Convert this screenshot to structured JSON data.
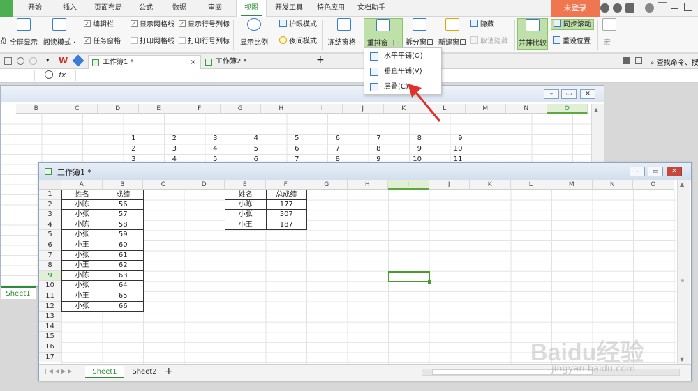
{
  "tabs": [
    "开始",
    "插入",
    "页面布局",
    "公式",
    "数据",
    "审阅",
    "视图",
    "开发工具",
    "特色应用",
    "文档助手"
  ],
  "login": "未登录",
  "ribbon": {
    "zoom_left": "览",
    "fullscreen": "全屏显示",
    "reading": "阅读模式 ·",
    "edit_bar": "编辑栏",
    "task_pane": "任务窗格",
    "show_grid": "显示网格线",
    "show_headers": "显示行号列标",
    "print_grid": "打印网格线",
    "print_headers": "打印行号列标",
    "zoom": "显示比例",
    "eye": "护眼模式",
    "night": "夜间模式",
    "freeze": "冻结窗格 ·",
    "arrange": "重排窗口 ·",
    "split": "拆分窗口",
    "new_window": "新建窗口",
    "hide": "隐藏",
    "unhide": "取消隐藏",
    "side_by_side": "并排比较",
    "sync_scroll": "同步滚动",
    "reset_pos": "重设位置",
    "macro": "宏 ·"
  },
  "doctabs": {
    "active": "工作簿1 *",
    "second": "工作簿2 *",
    "plus": "+",
    "search": "查找命令、搜"
  },
  "formula": {
    "fx": "fx"
  },
  "dropdown": {
    "horizontal": "水平平铺(O)",
    "vertical": "垂直平铺(V)",
    "cascade": "层叠(C)"
  },
  "back_window": {
    "columns": [
      "B",
      "C",
      "D",
      "E",
      "F",
      "G",
      "H",
      "I",
      "J",
      "K",
      "L",
      "M",
      "N",
      "O"
    ],
    "rows": [
      [
        "1",
        "2",
        "3",
        "4",
        "5",
        "6",
        "7",
        "8",
        "9"
      ],
      [
        "2",
        "3",
        "4",
        "5",
        "6",
        "7",
        "8",
        "9",
        "10"
      ],
      [
        "3",
        "4",
        "5",
        "6",
        "7",
        "8",
        "9",
        "10",
        "11"
      ]
    ],
    "sheet_tab": "Sheet1"
  },
  "front_window": {
    "title": "工作簿1 *",
    "columns": [
      "A",
      "B",
      "C",
      "D",
      "E",
      "F",
      "G",
      "H",
      "I",
      "J",
      "K",
      "L",
      "M",
      "N",
      "O"
    ],
    "row_numbers": [
      "1",
      "2",
      "3",
      "4",
      "5",
      "6",
      "7",
      "8",
      "9",
      "10",
      "11",
      "12",
      "13",
      "14",
      "15",
      "16",
      "17"
    ],
    "table1": {
      "header": [
        "姓名",
        "成绩"
      ],
      "rows": [
        [
          "小陈",
          "56"
        ],
        [
          "小张",
          "57"
        ],
        [
          "小陈",
          "58"
        ],
        [
          "小张",
          "59"
        ],
        [
          "小王",
          "60"
        ],
        [
          "小张",
          "61"
        ],
        [
          "小王",
          "62"
        ],
        [
          "小陈",
          "63"
        ],
        [
          "小张",
          "64"
        ],
        [
          "小王",
          "65"
        ],
        [
          "小张",
          "66"
        ]
      ]
    },
    "table2": {
      "header": [
        "姓名",
        "总成绩"
      ],
      "rows": [
        [
          "小陈",
          "177"
        ],
        [
          "小张",
          "307"
        ],
        [
          "小王",
          "187"
        ]
      ]
    },
    "sheets": [
      "Sheet1",
      "Sheet2"
    ],
    "add_sheet": "+"
  },
  "watermark": {
    "main": "Baidu经验",
    "sub": "jingyan.baidu.com"
  },
  "colors": {
    "accent": "#2e8b3a",
    "login": "#f07650",
    "arrow": "#e0302a"
  }
}
